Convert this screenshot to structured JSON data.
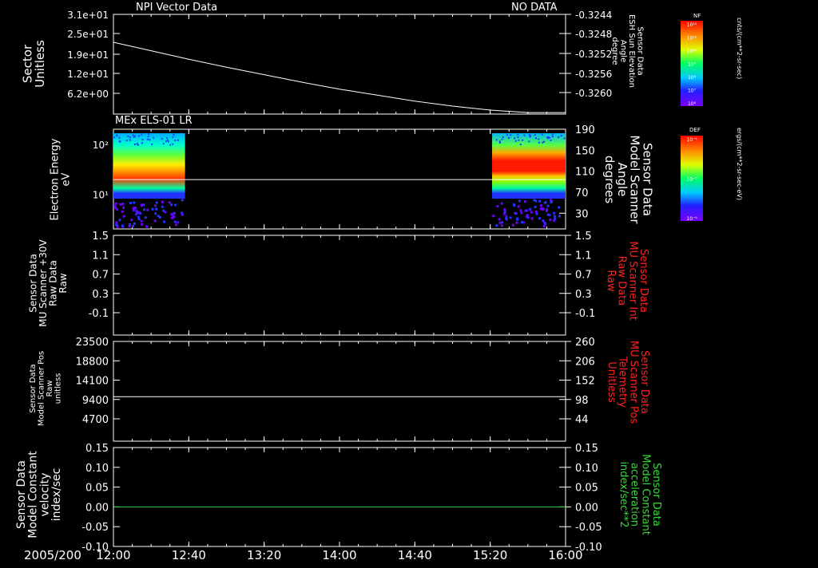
{
  "colors": {
    "background": "#000000",
    "foreground": "#ffffff",
    "red_label": "#ff2020",
    "green_label": "#33dd33",
    "zero_line": "#33cc33"
  },
  "time_axis": {
    "date": "2005/200",
    "ticks": [
      "12:00",
      "12:40",
      "13:20",
      "14:00",
      "14:40",
      "15:20",
      "16:00"
    ]
  },
  "chart_data": [
    {
      "type": "line",
      "title_left": "NPI Vector Data",
      "title_right": "NO DATA",
      "ylabel_left": [
        "Sector",
        "Unitless"
      ],
      "ylabel_right": [
        "Sensor Data",
        "ESH Sun Elevation",
        "Angle",
        "degree"
      ],
      "yticks_left": [
        "3.1e+01",
        "2.5e+01",
        "1.9e+01",
        "1.2e+01",
        "6.2e+00"
      ],
      "yticks_right": [
        "-0.3244",
        "-0.3248",
        "-0.3252",
        "-0.3256",
        "-0.3260"
      ],
      "ylim_right": [
        -0.3262,
        -0.3242
      ],
      "series": [
        {
          "x": [
            "12:00",
            "12:20",
            "12:40",
            "13:00",
            "13:20",
            "13:40",
            "14:00",
            "14:20",
            "14:40",
            "15:00",
            "15:20",
            "15:40",
            "16:00"
          ],
          "y": [
            -0.32476,
            -0.32493,
            -0.3251,
            -0.32526,
            -0.32541,
            -0.32556,
            -0.3257,
            -0.32582,
            -0.32594,
            -0.32604,
            -0.32612,
            -0.32617,
            -0.32617
          ]
        }
      ]
    },
    {
      "type": "heatmap",
      "title": "MEx ELS-01 LR",
      "ylabel_left": [
        "Electron Energy",
        "eV"
      ],
      "ylabel_right": [
        "Sensor Data",
        "Model Scanner",
        "Angle",
        "degrees"
      ],
      "yticks_left": [
        "10²",
        "10¹"
      ],
      "ylim_left": [
        0.3,
        2.3
      ],
      "yticks_right": [
        "190",
        "150",
        "110",
        "70",
        "30"
      ],
      "ylim_right": [
        0,
        190
      ],
      "data_intervals": [
        [
          "12:00",
          "12:38"
        ],
        [
          "15:21",
          "16:00"
        ]
      ],
      "line_right_value": 94,
      "colorbars": [
        {
          "label": "NF",
          "unit": "cnts/(cm**2-sr-sec)",
          "ticks": [
            "10¹²",
            "10¹¹",
            "10¹⁰",
            "10⁹",
            "10⁸",
            "10⁷",
            "10⁶"
          ]
        },
        {
          "label": "DEF",
          "unit": "ergs/(cm**2-sr-sec-eV)",
          "ticks": [
            "10⁻⁴",
            "10⁻⁵",
            "10⁻⁶"
          ]
        }
      ]
    },
    {
      "type": "line",
      "ylabel_left": [
        "Sensor Data",
        "MU Scanner +30V",
        "Raw Data",
        "Raw"
      ],
      "ylabel_right": [
        "Sensor Data",
        "MU Scanner Int",
        "Raw Data",
        "Raw"
      ],
      "yticks_left": [
        "1.5",
        "1.1",
        "0.7",
        "0.3",
        "-0.1"
      ],
      "yticks_right": [
        "1.5",
        "1.1",
        "0.7",
        "0.3",
        "-0.1"
      ],
      "ylim": [
        -0.4,
        1.5
      ],
      "series": []
    },
    {
      "type": "line",
      "ylabel_left": [
        "Sensor Data",
        "Model Scanner Pos",
        "Raw",
        "unitless"
      ],
      "ylabel_right": [
        "Sensor Data",
        "MU Scanner Pos",
        "Telemetry",
        "Unitless"
      ],
      "yticks_left": [
        "23500",
        "18800",
        "14100",
        "9400",
        "4700"
      ],
      "yticks_right": [
        "260",
        "206",
        "152",
        "98",
        "44"
      ],
      "ylim_left": [
        0,
        23500
      ],
      "ylim_right": [
        0,
        260
      ],
      "series": [
        {
          "axis": "right",
          "x": [
            "12:00",
            "16:00"
          ],
          "y": [
            116,
            116
          ]
        }
      ]
    },
    {
      "type": "line",
      "ylabel_left": [
        "Sensor Data",
        "Model Constant",
        "velocity",
        "index/sec"
      ],
      "ylabel_right": [
        "Sensor Data",
        "Model Constant",
        "acceleration",
        "index/sec**2"
      ],
      "yticks_left": [
        "0.15",
        "0.10",
        "0.05",
        "0.00",
        "-0.05",
        "-0.10"
      ],
      "yticks_right": [
        "0.15",
        "0.10",
        "0.05",
        "0.00",
        "-0.05",
        "-0.10"
      ],
      "ylim": [
        -0.1,
        0.15
      ],
      "series": [
        {
          "axis": "right",
          "x": [
            "12:00",
            "16:00"
          ],
          "y": [
            0.0,
            0.0
          ]
        }
      ]
    }
  ]
}
